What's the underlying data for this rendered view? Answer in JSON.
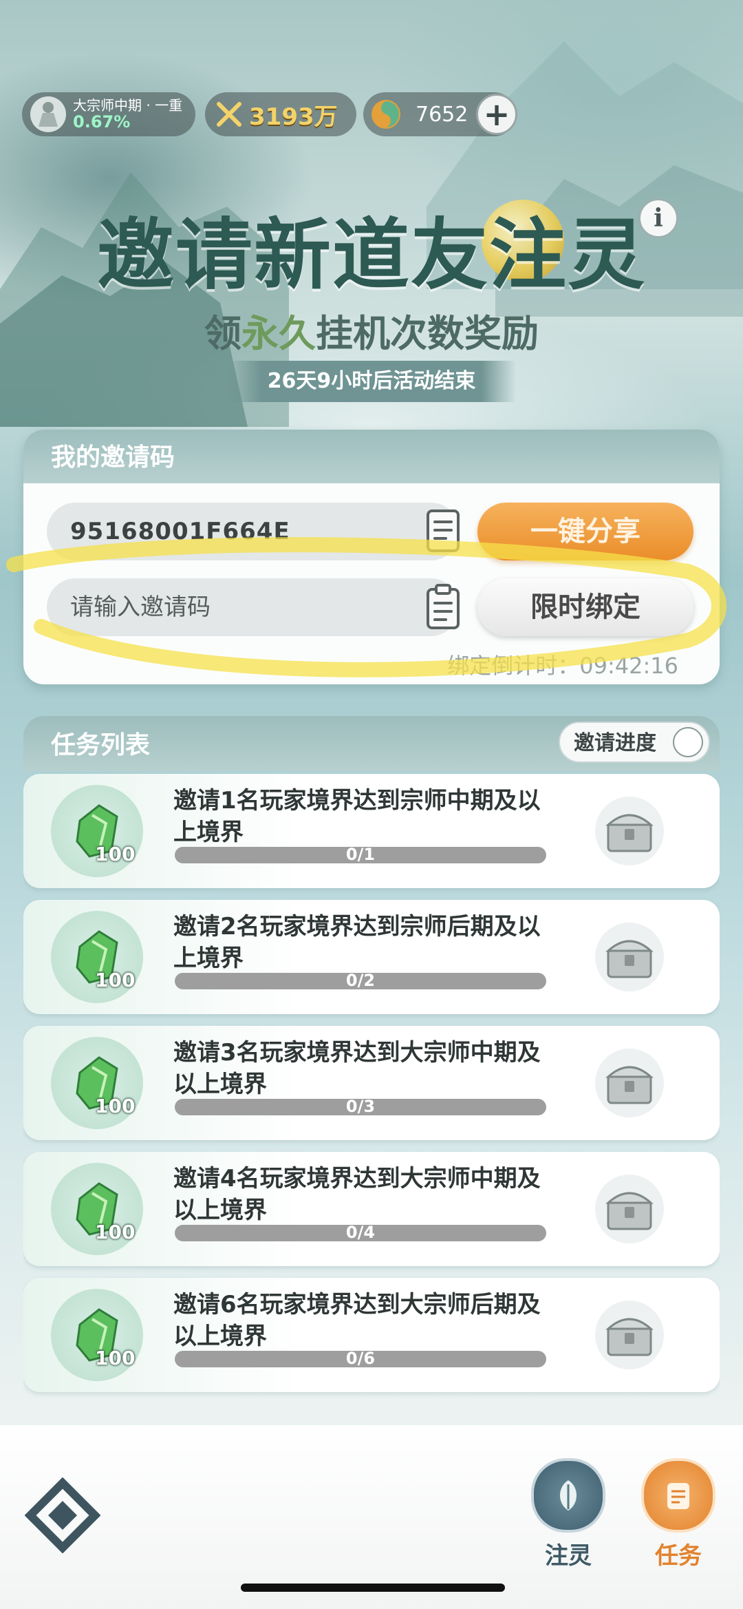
{
  "header": {
    "rank_title": "大宗师中期 · 一重",
    "rank_progress": "0.67%",
    "power": "3193万",
    "currency": "7652",
    "add_label": "+",
    "info_label": "i"
  },
  "event": {
    "title": "邀请新道友注灵",
    "subtitle_prefix": "领",
    "subtitle_highlight": "永久",
    "subtitle_suffix": "挂机次数奖励",
    "countdown": "26天9小时后活动结束"
  },
  "invite": {
    "header": "我的邀请码",
    "my_code": "95168001F664E",
    "share_label": "一键分享",
    "input_placeholder": "请输入邀请码",
    "bind_label": "限时绑定",
    "bind_countdown": "绑定倒计时：09:42:16"
  },
  "tasks": {
    "header": "任务列表",
    "progress_label": "邀请进度",
    "items": [
      {
        "title": "邀请1名玩家境界达到宗师中期及以上境界",
        "reward": "100",
        "progress": "0/1",
        "fraction": 0
      },
      {
        "title": "邀请2名玩家境界达到宗师后期及以上境界",
        "reward": "100",
        "progress": "0/2",
        "fraction": 0
      },
      {
        "title": "邀请3名玩家境界达到大宗师中期及以上境界",
        "reward": "100",
        "progress": "0/3",
        "fraction": 0
      },
      {
        "title": "邀请4名玩家境界达到大宗师中期及以上境界",
        "reward": "100",
        "progress": "0/4",
        "fraction": 0
      },
      {
        "title": "邀请6名玩家境界达到大宗师后期及以上境界",
        "reward": "100",
        "progress": "0/6",
        "fraction": 0
      }
    ]
  },
  "nav": {
    "zhuling_label": "注灵",
    "task_label": "任务"
  },
  "colors": {
    "accent_orange": "#ea8d2a",
    "title_green": "#2d5a52",
    "power_gold": "#f3d36a",
    "highlighter_yellow": "#f5e04a"
  }
}
